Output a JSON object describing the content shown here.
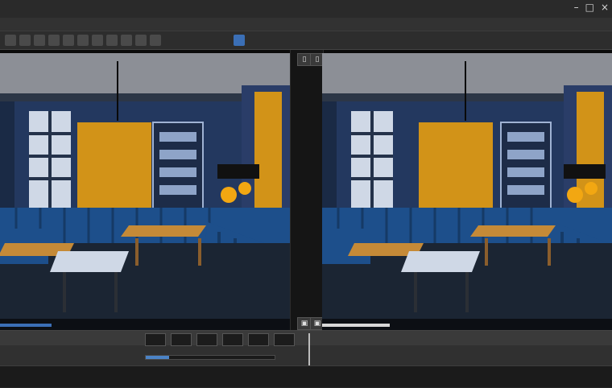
{
  "app": {
    "title": "",
    "menu": [],
    "toolbar_icons": [
      "tool-icon-1",
      "tool-icon-2",
      "tool-icon-3",
      "tool-icon-4",
      "tool-icon-5",
      "tool-icon-6",
      "tool-icon-7",
      "tool-icon-8",
      "tool-icon-9",
      "tool-icon-10",
      "tool-icon-11",
      "tool-icon-12"
    ],
    "window_controls": [
      "minimize-icon",
      "maximize-icon",
      "close-icon"
    ]
  },
  "viewports": {
    "left": {
      "header": ""
    },
    "right": {
      "header": ""
    }
  },
  "bottom": {
    "status": "",
    "progress_fraction": 0.18
  },
  "colors": {
    "wall": "#23385f",
    "sofa": "#1d4f8b",
    "accent_panel": "#d29318",
    "lamp": "#f2a712",
    "table": "#c58a37",
    "floor": "#1b2533"
  }
}
